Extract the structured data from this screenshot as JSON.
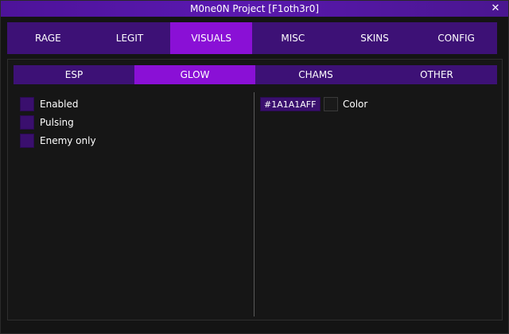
{
  "window": {
    "title": "M0ne0N Project [F1oth3r0]",
    "close_glyph": "✕"
  },
  "top_tabs": [
    {
      "label": "RAGE",
      "active": false
    },
    {
      "label": "LEGIT",
      "active": false
    },
    {
      "label": "VISUALS",
      "active": true
    },
    {
      "label": "MISC",
      "active": false
    },
    {
      "label": "SKINS",
      "active": false
    },
    {
      "label": "CONFIG",
      "active": false
    }
  ],
  "sub_tabs": [
    {
      "label": "ESP",
      "active": false
    },
    {
      "label": "GLOW",
      "active": true
    },
    {
      "label": "CHAMS",
      "active": false
    },
    {
      "label": "OTHER",
      "active": false
    }
  ],
  "glow": {
    "options": [
      {
        "label": "Enabled",
        "checked": false
      },
      {
        "label": "Pulsing",
        "checked": false
      },
      {
        "label": "Enemy only",
        "checked": false
      }
    ],
    "color": {
      "hex_value": "#1A1A1AFF",
      "label": "Color",
      "swatch_color": "#1a1a1a"
    }
  },
  "colors": {
    "accent": "#8a10d6",
    "tab_bg": "#3d1176",
    "title_bar": "#5a18b0"
  }
}
